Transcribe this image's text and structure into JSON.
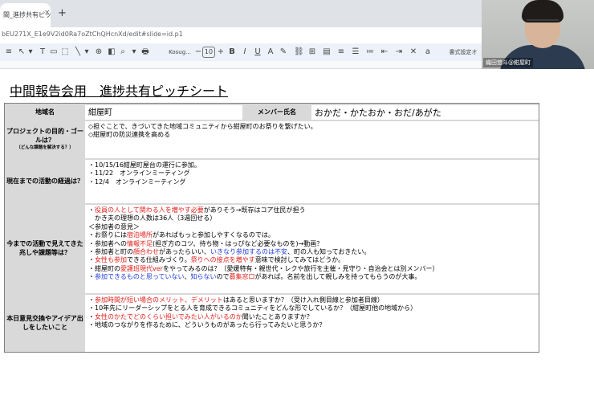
{
  "browser": {
    "tab_title": "間_進捗共有ピッチシ",
    "tab_close": "×",
    "new_tab": "+",
    "url": "bEU271X_E1e9V2id0Ra7oZtChQHcnXd/edit#slide=id.p1"
  },
  "toolbar": {
    "items": [
      "≡",
      "↶",
      "↷",
      "🖶",
      "◧",
      "▾",
      "⌕",
      "▾",
      "↖",
      "▾",
      "T",
      "▭",
      "⬚",
      "╲",
      "▾",
      "⊕"
    ],
    "font_name": "Kosug...",
    "font_minus": "−",
    "font_size": "10",
    "font_plus": "+",
    "format_buttons": [
      "B",
      "I",
      "U",
      "A",
      "✎",
      "⛓",
      "⊞",
      "▤",
      "≡",
      "☰",
      "≔",
      "⇤",
      "⇥",
      "✕",
      "a"
    ],
    "format_options": "書式設定オ"
  },
  "video": {
    "participant_name": "織田悠斗@紺屋町"
  },
  "slide": {
    "title": "中間報告会用　進捗共有ピッチシート",
    "header": {
      "area_label": "地域名",
      "area_value": "紺屋町",
      "members_label": "メンバー氏名",
      "members_value": "おかだ・かたおか・おだ/あがた"
    },
    "rows": [
      {
        "label": "プロジェクトの目的・ゴールは？",
        "note": "（どんな課題を解決する？）",
        "lines": [
          [
            {
              "t": "◇担ぐことで、きづいてきた地域コミュニティから紺屋町のお祭りを繋げたい。"
            }
          ],
          [
            {
              "t": "◇紺屋町の防災連携を高める"
            }
          ]
        ]
      },
      {
        "label": "現在までの活動の経過は？",
        "note": "",
        "lines": [
          [
            {
              "t": "・10/15/16紺屋町屋台の運行に参加。"
            }
          ],
          [
            {
              "t": "・11/22　オンラインミーティング"
            }
          ],
          [
            {
              "t": "・12/4　オンラインミーティング"
            }
          ]
        ]
      },
      {
        "label": "今までの活動で見えてきた兆しや課題等は？",
        "note": "",
        "lines": [
          [
            {
              "t": "・"
            },
            {
              "t": "役員の人として関わる人を増やす必要",
              "c": "red"
            },
            {
              "t": "がありそう→既存はコア住民が担う"
            }
          ],
          [
            {
              "t": "　かき夫の理想の人数は36人（3週回せる）"
            }
          ],
          [
            {
              "t": "＜参加者の意見＞"
            }
          ],
          [
            {
              "t": "・お祭りには"
            },
            {
              "t": "宿泊場所",
              "c": "red"
            },
            {
              "t": "があればもっと参加しやすくなるのでは。"
            }
          ],
          [
            {
              "t": "・参加者への"
            },
            {
              "t": "情報不足",
              "c": "red"
            },
            {
              "t": "(担ぎ方のコツ、持ち物・はっぴなど必要なものを)→動画？"
            }
          ],
          [
            {
              "t": "・参加者と町の"
            },
            {
              "t": "顔合わせ",
              "c": "red"
            },
            {
              "t": "があったらいい、"
            },
            {
              "t": "いきなり参加するのは不安",
              "c": "blue"
            },
            {
              "t": "、町の人も知っておきたい。"
            }
          ],
          [
            {
              "t": "・"
            },
            {
              "t": "女性も参加",
              "c": "red"
            },
            {
              "t": "できる仕組みづくり。"
            },
            {
              "t": "祭りへの接点を増やす",
              "c": "red"
            },
            {
              "t": "意味で検討してみてはどうか。"
            }
          ],
          [
            {
              "t": "・紺屋町の"
            },
            {
              "t": "愛護班現代ver",
              "c": "red"
            },
            {
              "t": "をやってみるのは？（愛媛特有・親世代・レクや旅行を主催・見守り・自治会とは別メンバー）"
            }
          ],
          [
            {
              "t": "・"
            },
            {
              "t": "参加できるものと思っていない",
              "c": "blue"
            },
            {
              "t": "、"
            },
            {
              "t": "知らない",
              "c": "blue"
            },
            {
              "t": "ので"
            },
            {
              "t": "募集窓口",
              "c": "red"
            },
            {
              "t": "があれば。名前を出して親しみを持ってもらうのが大事。"
            }
          ]
        ]
      },
      {
        "label": "本日意見交換やアイデア出しをしたいこと",
        "note": "",
        "lines": [
          [
            {
              "t": "・"
            },
            {
              "t": "参加時間が短い場合のメリット、デメリット",
              "c": "red"
            },
            {
              "t": "はあると思いますか？（受け入れ側目線と参加者目線）"
            }
          ],
          [
            {
              "t": "・10年先にリーダーシップをとる人を育成できるコミュニティをどんな形でしているか？（紺屋町他の地域から）"
            }
          ],
          [
            {
              "t": "・"
            },
            {
              "t": "女性のかたでどのくらい担いでみたい人がいるのか",
              "c": "red"
            },
            {
              "t": "聞いたことありますか？"
            }
          ],
          [
            {
              "t": "・地域のつながりを作るために、どういうものがあったら行ってみたいと思うか？"
            }
          ]
        ]
      }
    ]
  },
  "colors": {
    "highlight_red": "#e0201b",
    "highlight_blue": "#1f3bd6",
    "label_cell": "#d9d9d9",
    "toolbar": "#edf2fa"
  }
}
